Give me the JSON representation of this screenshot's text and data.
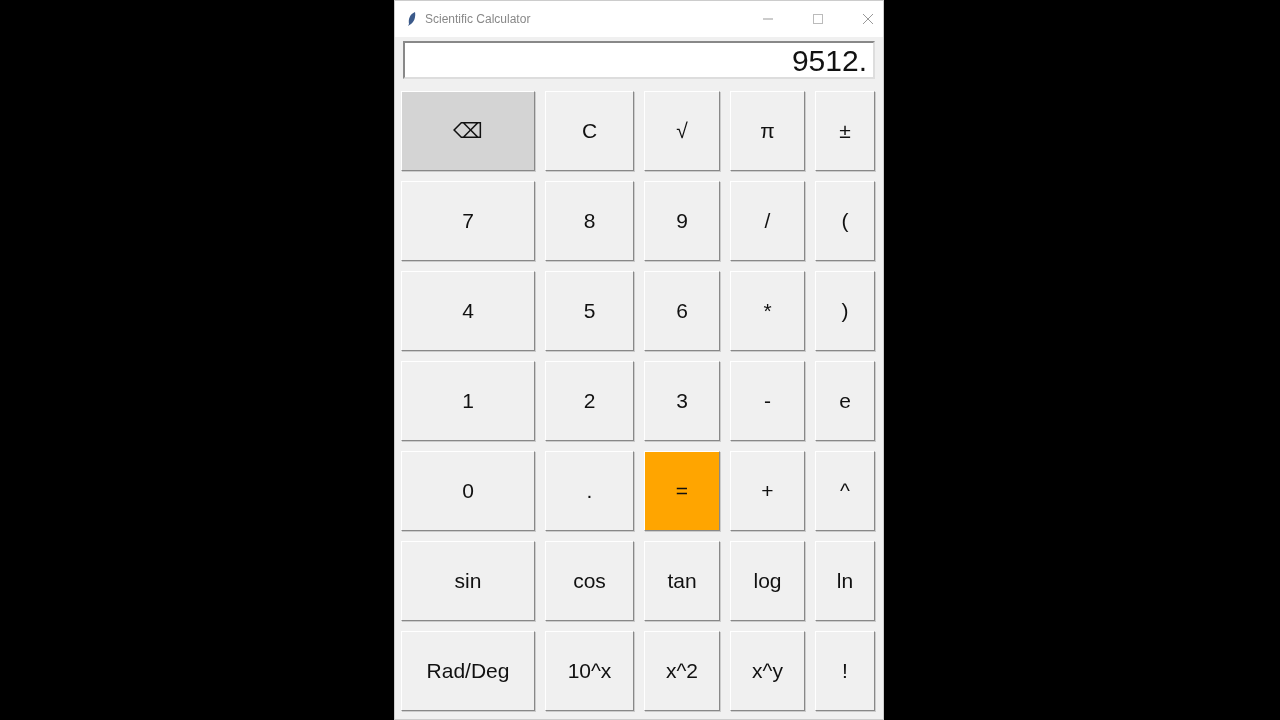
{
  "window": {
    "title": "Scientific Calculator"
  },
  "display": {
    "value": "9512."
  },
  "keys": [
    {
      "label": "⌫",
      "kind": "pressed"
    },
    {
      "label": "C",
      "kind": "normal"
    },
    {
      "label": "√",
      "kind": "normal"
    },
    {
      "label": "π",
      "kind": "normal"
    },
    {
      "label": "±",
      "kind": "normal"
    },
    {
      "label": "7",
      "kind": "normal"
    },
    {
      "label": "8",
      "kind": "normal"
    },
    {
      "label": "9",
      "kind": "normal"
    },
    {
      "label": "/",
      "kind": "normal"
    },
    {
      "label": "(",
      "kind": "normal"
    },
    {
      "label": "4",
      "kind": "normal"
    },
    {
      "label": "5",
      "kind": "normal"
    },
    {
      "label": "6",
      "kind": "normal"
    },
    {
      "label": "*",
      "kind": "normal"
    },
    {
      "label": ")",
      "kind": "normal"
    },
    {
      "label": "1",
      "kind": "normal"
    },
    {
      "label": "2",
      "kind": "normal"
    },
    {
      "label": "3",
      "kind": "normal"
    },
    {
      "label": "-",
      "kind": "normal"
    },
    {
      "label": "e",
      "kind": "normal"
    },
    {
      "label": "0",
      "kind": "normal"
    },
    {
      "label": ".",
      "kind": "normal"
    },
    {
      "label": "=",
      "kind": "accent"
    },
    {
      "label": "+",
      "kind": "normal"
    },
    {
      "label": "^",
      "kind": "normal"
    },
    {
      "label": "sin",
      "kind": "normal"
    },
    {
      "label": "cos",
      "kind": "normal"
    },
    {
      "label": "tan",
      "kind": "normal"
    },
    {
      "label": "log",
      "kind": "normal"
    },
    {
      "label": "ln",
      "kind": "normal"
    },
    {
      "label": "Rad/Deg",
      "kind": "normal"
    },
    {
      "label": "10^x",
      "kind": "normal"
    },
    {
      "label": "x^2",
      "kind": "normal"
    },
    {
      "label": "x^y",
      "kind": "normal"
    },
    {
      "label": "!",
      "kind": "normal"
    }
  ]
}
